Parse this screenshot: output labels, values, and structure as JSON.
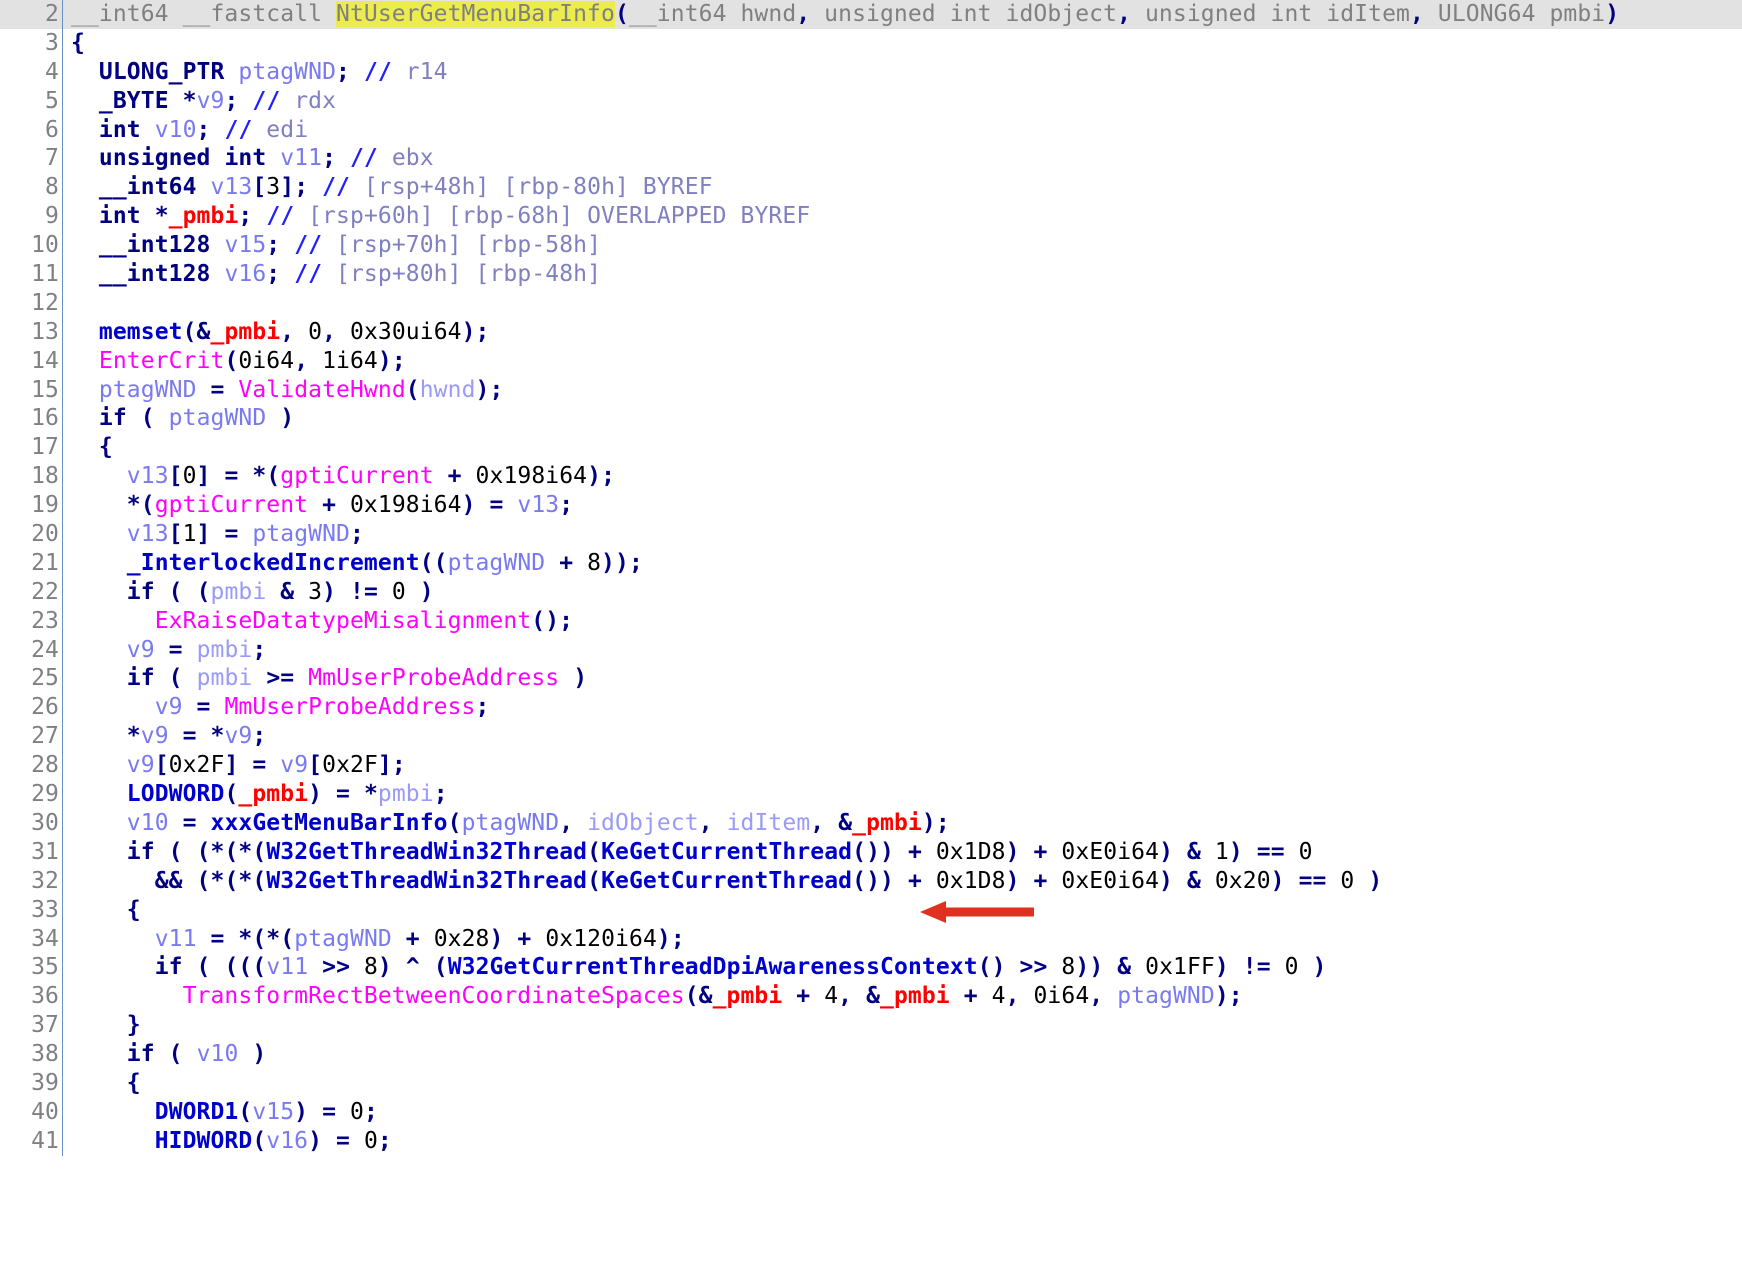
{
  "view": {
    "kind": "ida-pseudocode-decompiler",
    "title": "NtUserGetMenuBarInfo pseudocode",
    "first_visible_line": 2,
    "last_visible_line": 41,
    "highlighted_symbol": "NtUserGetMenuBarInfo",
    "marked_variable": "_pmbi"
  },
  "colors": {
    "background": "#ffffff",
    "line_number": "#808080",
    "current_line_background": "#e2e2e2",
    "symbol_highlight": "#ecec4e",
    "keyword": "#000080",
    "library_function": "#0000cc",
    "global_function": "#ff00ff",
    "local_variable": "#7a7af0",
    "argument": "#9a9af8",
    "comment": "#8080c0",
    "marked_variable": "#ff0000",
    "breakpoint_dot": "#9fd2f2",
    "gutter_separator": "#6a8fc4",
    "annotation_arrow": "#e03020"
  },
  "annotation": {
    "type": "arrow",
    "direction": "left",
    "color": "#e03020",
    "points_at_line": 30,
    "points_at_text": "v10 = xxxGetMenuBarInfo(ptagWND, idObject, idItem, &_pmbi);"
  },
  "lines": [
    {
      "n": 2,
      "bp": false,
      "hl": true,
      "indent": 0,
      "text": "__int64 __fastcall NtUserGetMenuBarInfo(__int64 hwnd, unsigned int idObject, unsigned int idItem, ULONG64 pmbi)"
    },
    {
      "n": 3,
      "bp": false,
      "hl": false,
      "indent": 0,
      "text": "{"
    },
    {
      "n": 4,
      "bp": false,
      "hl": false,
      "indent": 1,
      "text": "ULONG_PTR ptagWND; // r14"
    },
    {
      "n": 5,
      "bp": false,
      "hl": false,
      "indent": 1,
      "text": "_BYTE *v9; // rdx"
    },
    {
      "n": 6,
      "bp": false,
      "hl": false,
      "indent": 1,
      "text": "int v10; // edi"
    },
    {
      "n": 7,
      "bp": false,
      "hl": false,
      "indent": 1,
      "text": "unsigned int v11; // ebx"
    },
    {
      "n": 8,
      "bp": false,
      "hl": false,
      "indent": 1,
      "text": "__int64 v13[3]; // [rsp+48h] [rbp-80h] BYREF"
    },
    {
      "n": 9,
      "bp": false,
      "hl": false,
      "indent": 1,
      "text": "int *_pmbi; // [rsp+60h] [rbp-68h] OVERLAPPED BYREF"
    },
    {
      "n": 10,
      "bp": false,
      "hl": false,
      "indent": 1,
      "text": "__int128 v15; // [rsp+70h] [rbp-58h]"
    },
    {
      "n": 11,
      "bp": false,
      "hl": false,
      "indent": 1,
      "text": "__int128 v16; // [rsp+80h] [rbp-48h]"
    },
    {
      "n": 12,
      "bp": false,
      "hl": false,
      "indent": 0,
      "text": ""
    },
    {
      "n": 13,
      "bp": true,
      "hl": false,
      "indent": 1,
      "text": "memset(&_pmbi, 0, 0x30ui64);"
    },
    {
      "n": 14,
      "bp": true,
      "hl": false,
      "indent": 1,
      "text": "EnterCrit(0i64, 1i64);"
    },
    {
      "n": 15,
      "bp": true,
      "hl": false,
      "indent": 1,
      "text": "ptagWND = ValidateHwnd(hwnd);"
    },
    {
      "n": 16,
      "bp": true,
      "hl": false,
      "indent": 1,
      "text": "if ( ptagWND )"
    },
    {
      "n": 17,
      "bp": false,
      "hl": false,
      "indent": 1,
      "text": "{"
    },
    {
      "n": 18,
      "bp": true,
      "hl": false,
      "indent": 2,
      "text": "v13[0] = *(gptiCurrent + 0x198i64);"
    },
    {
      "n": 19,
      "bp": true,
      "hl": false,
      "indent": 2,
      "text": "*(gptiCurrent + 0x198i64) = v13;"
    },
    {
      "n": 20,
      "bp": true,
      "hl": false,
      "indent": 2,
      "text": "v13[1] = ptagWND;"
    },
    {
      "n": 21,
      "bp": true,
      "hl": false,
      "indent": 2,
      "text": "_InterlockedIncrement((ptagWND + 8));"
    },
    {
      "n": 22,
      "bp": true,
      "hl": false,
      "indent": 2,
      "text": "if ( (pmbi & 3) != 0 )"
    },
    {
      "n": 23,
      "bp": true,
      "hl": false,
      "indent": 3,
      "text": "ExRaiseDatatypeMisalignment();"
    },
    {
      "n": 24,
      "bp": true,
      "hl": false,
      "indent": 2,
      "text": "v9 = pmbi;"
    },
    {
      "n": 25,
      "bp": true,
      "hl": false,
      "indent": 2,
      "text": "if ( pmbi >= MmUserProbeAddress )"
    },
    {
      "n": 26,
      "bp": true,
      "hl": false,
      "indent": 3,
      "text": "v9 = MmUserProbeAddress;"
    },
    {
      "n": 27,
      "bp": true,
      "hl": false,
      "indent": 2,
      "text": "*v9 = *v9;"
    },
    {
      "n": 28,
      "bp": true,
      "hl": false,
      "indent": 2,
      "text": "v9[0x2F] = v9[0x2F];"
    },
    {
      "n": 29,
      "bp": true,
      "hl": false,
      "indent": 2,
      "text": "LODWORD(_pmbi) = *pmbi;"
    },
    {
      "n": 30,
      "bp": true,
      "hl": false,
      "indent": 2,
      "text": "v10 = xxxGetMenuBarInfo(ptagWND, idObject, idItem, &_pmbi);"
    },
    {
      "n": 31,
      "bp": true,
      "hl": false,
      "indent": 2,
      "text": "if ( (*(*(W32GetThreadWin32Thread(KeGetCurrentThread()) + 0x1D8) + 0xE0i64) & 1) == 0"
    },
    {
      "n": 32,
      "bp": false,
      "hl": false,
      "indent": 3,
      "text": "&& (*(*(W32GetThreadWin32Thread(KeGetCurrentThread()) + 0x1D8) + 0xE0i64) & 0x20) == 0 )"
    },
    {
      "n": 33,
      "bp": false,
      "hl": false,
      "indent": 2,
      "text": "{"
    },
    {
      "n": 34,
      "bp": true,
      "hl": false,
      "indent": 3,
      "text": "v11 = *(*(ptagWND + 0x28) + 0x120i64);"
    },
    {
      "n": 35,
      "bp": true,
      "hl": false,
      "indent": 3,
      "text": "if ( (((v11 >> 8) ^ (W32GetCurrentThreadDpiAwarenessContext() >> 8)) & 0x1FF) != 0 )"
    },
    {
      "n": 36,
      "bp": true,
      "hl": false,
      "indent": 4,
      "text": "TransformRectBetweenCoordinateSpaces(&_pmbi + 4, &_pmbi + 4, 0i64, ptagWND);"
    },
    {
      "n": 37,
      "bp": false,
      "hl": false,
      "indent": 2,
      "text": "}"
    },
    {
      "n": 38,
      "bp": true,
      "hl": false,
      "indent": 2,
      "text": "if ( v10 )"
    },
    {
      "n": 39,
      "bp": false,
      "hl": false,
      "indent": 2,
      "text": "{"
    },
    {
      "n": 40,
      "bp": true,
      "hl": false,
      "indent": 3,
      "text": "DWORD1(v15) = 0;"
    },
    {
      "n": 41,
      "bp": true,
      "hl": false,
      "indent": 3,
      "text": "HIDWORD(v16) = 0;"
    }
  ],
  "tokens": {
    "keywords": [
      "if",
      "int",
      "unsigned",
      "__int64",
      "__int128",
      "__fastcall",
      "ULONG_PTR",
      "_BYTE",
      "ULONG64"
    ],
    "library_functions": [
      "memset",
      "_InterlockedIncrement",
      "xxxGetMenuBarInfo",
      "W32GetThreadWin32Thread",
      "KeGetCurrentThread",
      "W32GetCurrentThreadDpiAwarenessContext",
      "LODWORD",
      "DWORD1",
      "HIDWORD"
    ],
    "global_functions": [
      "EnterCrit",
      "ValidateHwnd",
      "ExRaiseDatatypeMisalignment",
      "TransformRectBetweenCoordinateSpaces"
    ],
    "global_variables": [
      "gptiCurrent",
      "MmUserProbeAddress"
    ],
    "local_variables": [
      "ptagWND",
      "v9",
      "v10",
      "v11",
      "v13",
      "v15",
      "v16",
      "_pmbi"
    ],
    "arguments": [
      "hwnd",
      "idObject",
      "idItem",
      "pmbi"
    ]
  }
}
